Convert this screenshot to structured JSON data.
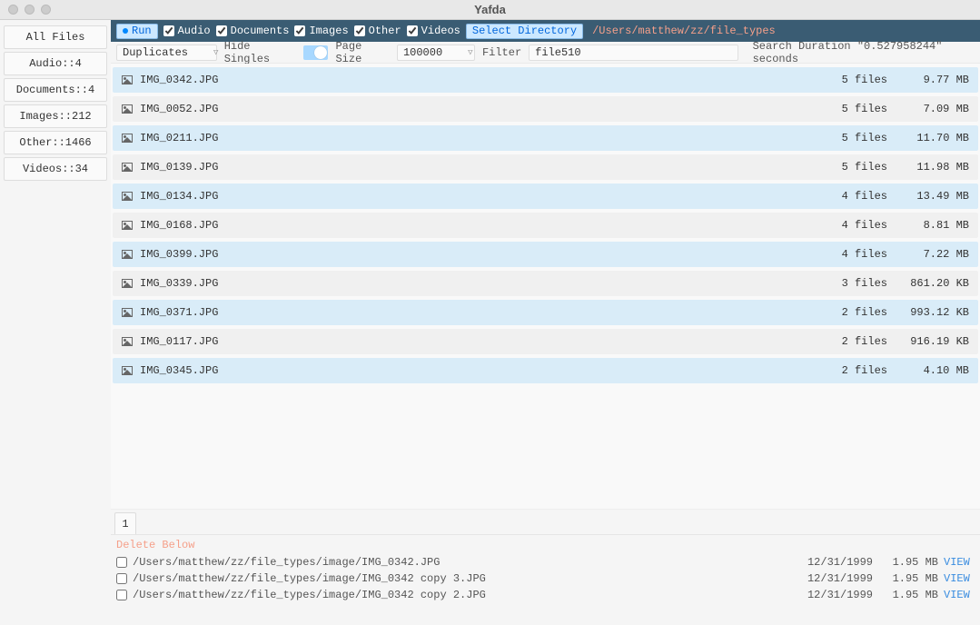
{
  "window": {
    "title": "Yafda"
  },
  "toolbar": {
    "run_label": "Run",
    "types": [
      {
        "label": "Audio",
        "checked": true
      },
      {
        "label": "Documents",
        "checked": true
      },
      {
        "label": "Images",
        "checked": true
      },
      {
        "label": "Other",
        "checked": true
      },
      {
        "label": "Videos",
        "checked": true
      }
    ],
    "select_directory_label": "Select Directory",
    "directory_path": "/Users/matthew/zz/file_types"
  },
  "controls": {
    "sort_mode": "Duplicates",
    "hide_singles_label": "Hide Singles",
    "hide_singles_on": true,
    "page_size_label": "Page Size",
    "page_size": "100000",
    "filter_label": "Filter",
    "filter_value": "file510",
    "search_stats_prefix": "Search Duration ",
    "search_duration_quoted": "\"0.527958244\"",
    "search_stats_suffix": " seconds"
  },
  "sidebar": {
    "items": [
      "All Files",
      "Audio::4",
      "Documents::4",
      "Images::212",
      "Other::1466",
      "Videos::34"
    ]
  },
  "list": {
    "rows": [
      {
        "name": "IMG_0342.JPG",
        "count": "5 files",
        "size": "9.77 MB"
      },
      {
        "name": "IMG_0052.JPG",
        "count": "5 files",
        "size": "7.09 MB"
      },
      {
        "name": "IMG_0211.JPG",
        "count": "5 files",
        "size": "11.70 MB"
      },
      {
        "name": "IMG_0139.JPG",
        "count": "5 files",
        "size": "11.98 MB"
      },
      {
        "name": "IMG_0134.JPG",
        "count": "4 files",
        "size": "13.49 MB"
      },
      {
        "name": "IMG_0168.JPG",
        "count": "4 files",
        "size": "8.81 MB"
      },
      {
        "name": "IMG_0399.JPG",
        "count": "4 files",
        "size": "7.22 MB"
      },
      {
        "name": "IMG_0339.JPG",
        "count": "3 files",
        "size": "861.20 KB"
      },
      {
        "name": "IMG_0371.JPG",
        "count": "2 files",
        "size": "993.12 KB"
      },
      {
        "name": "IMG_0117.JPG",
        "count": "2 files",
        "size": "916.19 KB"
      },
      {
        "name": "IMG_0345.JPG",
        "count": "2 files",
        "size": "4.10 MB"
      }
    ]
  },
  "pager": {
    "current": "1"
  },
  "details": {
    "delete_below": "Delete Below",
    "view_label": "VIEW",
    "rows": [
      {
        "path": "/Users/matthew/zz/file_types/image/IMG_0342.JPG",
        "date": "12/31/1999",
        "size": "1.95 MB"
      },
      {
        "path": "/Users/matthew/zz/file_types/image/IMG_0342 copy 3.JPG",
        "date": "12/31/1999",
        "size": "1.95 MB"
      },
      {
        "path": "/Users/matthew/zz/file_types/image/IMG_0342 copy 2.JPG",
        "date": "12/31/1999",
        "size": "1.95 MB"
      }
    ]
  }
}
